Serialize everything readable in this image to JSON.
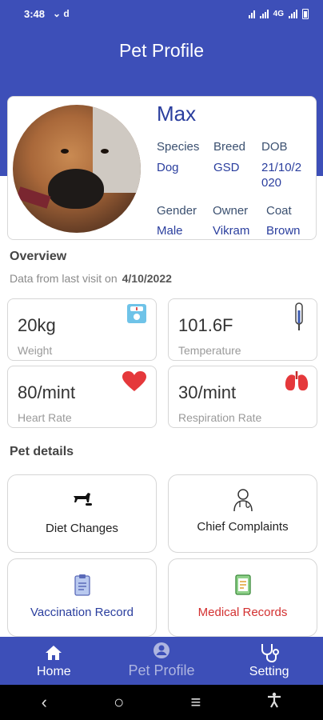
{
  "status_bar": {
    "time": "3:48",
    "notifications": "⌄ d",
    "network": "4G"
  },
  "header": {
    "title": "Pet Profile"
  },
  "profile": {
    "name": "Max",
    "fields": [
      {
        "label": "Species",
        "value": "Dog"
      },
      {
        "label": "Breed",
        "value": "GSD"
      },
      {
        "label": "DOB",
        "value": "21/10/2\n020"
      },
      {
        "label": "Gender",
        "value": "Male"
      },
      {
        "label": "Owner",
        "value": "Vikram"
      },
      {
        "label": "Coat",
        "value": "Brown"
      }
    ]
  },
  "overview": {
    "title": "Overview",
    "subtitle": "Data from last visit on",
    "date": "4/10/2022",
    "stats": [
      {
        "value": "20kg",
        "label": "Weight",
        "icon": "weighing-scale-icon"
      },
      {
        "value": "101.6F",
        "label": "Temperature",
        "icon": "thermometer-icon"
      },
      {
        "value": "80/mint",
        "label": "Heart Rate",
        "icon": "heart-icon"
      },
      {
        "value": "30/mint",
        "label": "Respiration Rate",
        "icon": "lungs-icon"
      }
    ]
  },
  "pet_details": {
    "title": "Pet details",
    "items": [
      {
        "label": "Diet Changes",
        "icon": "dog-feeding-icon",
        "color": "#222222"
      },
      {
        "label": "Chief Complaints",
        "icon": "doctor-icon",
        "color": "#222222"
      },
      {
        "label": "Vaccination Record",
        "icon": "clipboard-icon",
        "color": "#2a3e9e"
      },
      {
        "label": "Medical Records",
        "icon": "medical-report-icon",
        "color": "#d33030"
      }
    ]
  },
  "bottom_nav": {
    "items": [
      {
        "label": "Home",
        "icon": "home-icon",
        "active": true
      },
      {
        "label": "Pet Profile",
        "icon": "profile-icon",
        "active": false
      },
      {
        "label": "Setting",
        "icon": "stethoscope-icon",
        "active": true
      }
    ]
  },
  "colors": {
    "primary": "#3d4fb8",
    "accent_text": "#2a3e9e",
    "danger": "#d33030"
  }
}
